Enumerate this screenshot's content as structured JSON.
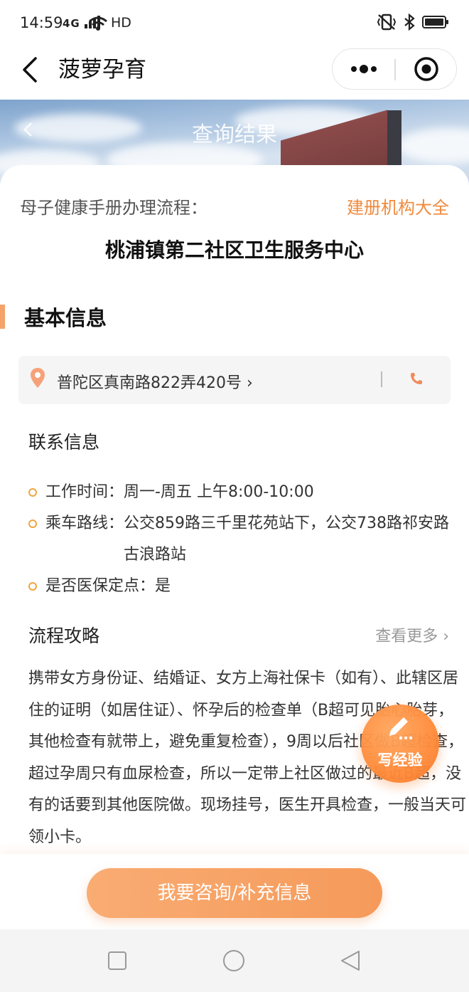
{
  "status_bar": {
    "time": "14:59",
    "signal_text": "4G",
    "hd": "HD"
  },
  "nav": {
    "title": "菠萝孕育"
  },
  "hero": {
    "title": "查询结果"
  },
  "card": {
    "handbook_label": "母子健康手册办理流程：",
    "directory_link": "建册机构大全",
    "center_name": "桃浦镇第二社区卫生服务中心",
    "section_title": "基本信息",
    "address": "普陀区真南路822弄420号 ›"
  },
  "contact": {
    "title": "联系信息",
    "items": [
      {
        "label": "工作时间：",
        "value": "周一-周五 上午8:00-10:00"
      },
      {
        "label": "乘车路线：",
        "value": "公交859路三千里花苑站下，公交738路祁安路古浪路站"
      },
      {
        "label": "是否医保定点：",
        "value": "是"
      }
    ]
  },
  "guide": {
    "title": "流程攻略",
    "see_more": "查看更多 ›",
    "text": "携带女方身份证、结婚证、女方上海社保卡（如有）、此辖区居住的证明（如居住证）、怀孕后的检查单（B超可见胎心胎芽，其他检查有就带上，避免重复检查），9周以后社区做B超检查，超过孕周只有血尿检查，所以一定带上社区做过的最近B超，没有的话要到其他医院做。现场挂号，医生开具检查，一般当天可领小卡。"
  },
  "fab": {
    "label": "写经验"
  },
  "bottom": {
    "consult_button": "我要咨询/补充信息"
  },
  "colors": {
    "accent": "#f08a3c",
    "button_gradient_start": "#f9ac73",
    "button_gradient_end": "#f59a5a",
    "dot": "#f0a542"
  }
}
